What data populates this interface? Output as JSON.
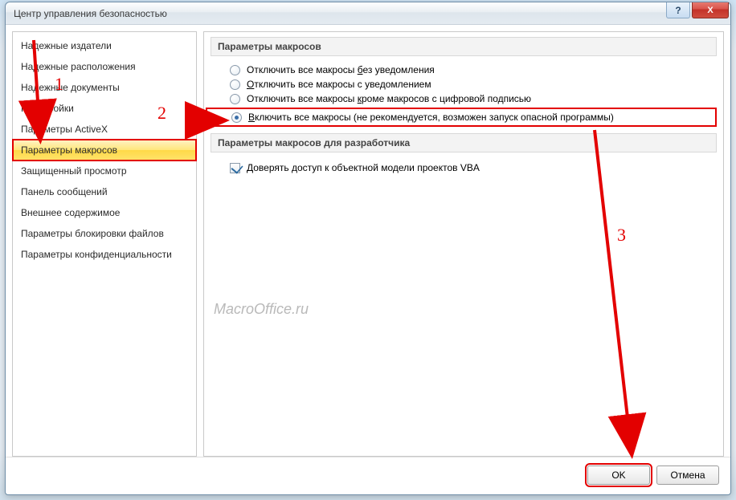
{
  "window": {
    "title": "Центр управления безопасностью",
    "help_label": "?",
    "close_label": "X"
  },
  "sidebar": {
    "items": [
      {
        "label": "Надежные издатели"
      },
      {
        "label": "Надежные расположения"
      },
      {
        "label": "Надежные документы"
      },
      {
        "label": "Надстройки"
      },
      {
        "label": "Параметры ActiveX"
      },
      {
        "label": "Параметры макросов",
        "selected": true
      },
      {
        "label": "Защищенный просмотр"
      },
      {
        "label": "Панель сообщений"
      },
      {
        "label": "Внешнее содержимое"
      },
      {
        "label": "Параметры блокировки файлов"
      },
      {
        "label": "Параметры конфиденциальности"
      }
    ]
  },
  "main": {
    "group1_title": "Параметры макросов",
    "radios": [
      {
        "pre": "Отключить все макросы ",
        "u": "б",
        "post": "ез уведомления",
        "checked": false
      },
      {
        "pre": "",
        "u": "О",
        "post": "тключить все макросы с уведомлением",
        "checked": false
      },
      {
        "pre": "Отключить все макросы ",
        "u": "к",
        "post": "роме макросов с цифровой подписью",
        "checked": false
      },
      {
        "pre": "",
        "u": "В",
        "post": "ключить все макросы (не рекомендуется, возможен запуск опасной программы)",
        "checked": true
      }
    ],
    "group2_title": "Параметры макросов для разработчика",
    "trust_checkbox": {
      "label": "Доверять доступ к объектной модели проектов VBA",
      "checked": true
    }
  },
  "footer": {
    "ok": "OK",
    "cancel": "Отмена"
  },
  "watermark": "MacroOffice.ru",
  "annotations": {
    "n1": "1",
    "n2": "2",
    "n3": "3"
  }
}
